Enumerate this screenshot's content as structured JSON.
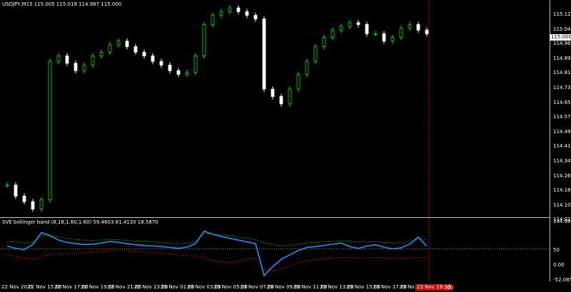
{
  "main": {
    "symbol_header": "USDJPY,M15  115.005 115.019 114.987 115.000",
    "current_price": "115.000",
    "price_labels": [
      "115.125",
      "115.045",
      "114.965",
      "114.890",
      "114.810",
      "114.730",
      "114.650",
      "114.575",
      "114.495",
      "114.415",
      "114.340",
      "114.260",
      "114.180",
      "114.100",
      "114.025"
    ]
  },
  "indicator": {
    "header": "SVE bollinger band (8,18,1.60,1.60) 59.4603 81.4130 18.5870",
    "labels": [
      "144.9853",
      "50",
      "0.00",
      "-52.0858"
    ]
  },
  "time_axis": {
    "labels": [
      "22 Nov 2021",
      "22 Nov 15:00",
      "22 Nov 17:00",
      "22 Nov 19:00",
      "22 Nov 21:00",
      "22 Nov 23:00",
      "23 Nov 01:00",
      "23 Nov 03:00",
      "23 Nov 05:00",
      "23 Nov 07:00",
      "23 Nov 09:00",
      "23 Nov 11:00",
      "23 Nov 13:00",
      "23 Nov 15:00",
      "23 Nov 17:00",
      "23 No"
    ],
    "crosshair_tag": "23 Nov 19:30",
    "crosshair_suffix": ":00"
  },
  "colors": {
    "bull": "#00e000",
    "bear": "#ffffff",
    "indicator_line": "#1e90ff",
    "upper_band": "#00c000",
    "lower_band": "#e00000",
    "crosshair": "#e00000"
  },
  "chart_data": {
    "type": "line",
    "close_series": [
      114.18,
      114.12,
      114.09,
      114.05,
      114.1,
      114.85,
      114.88,
      114.84,
      114.8,
      114.83,
      114.88,
      114.9,
      114.94,
      114.96,
      114.93,
      114.9,
      114.88,
      114.85,
      114.83,
      114.8,
      114.78,
      114.79,
      114.88,
      115.05,
      115.1,
      115.12,
      115.14,
      115.12,
      115.1,
      115.08,
      114.7,
      114.66,
      114.62,
      114.7,
      114.78,
      114.85,
      114.93,
      114.98,
      115.02,
      115.04,
      115.06,
      115.05,
      115.0,
      115.0,
      114.96,
      114.98,
      115.03,
      115.05,
      115.02,
      115.0
    ],
    "indicator_series": [
      59,
      52,
      48,
      65,
      105,
      95,
      80,
      72,
      68,
      65,
      66,
      70,
      75,
      72,
      68,
      64,
      62,
      60,
      58,
      55,
      52,
      56,
      68,
      110,
      100,
      92,
      86,
      80,
      74,
      68,
      -40,
      -10,
      15,
      30,
      45,
      55,
      58,
      62,
      66,
      70,
      58,
      52,
      60,
      64,
      56,
      50,
      54,
      66,
      90,
      59
    ],
    "upper_band_series": [
      75,
      74,
      70,
      72,
      95,
      96,
      90,
      86,
      82,
      80,
      79,
      80,
      82,
      81,
      79,
      77,
      76,
      74,
      72,
      70,
      68,
      69,
      75,
      102,
      100,
      98,
      95,
      90,
      86,
      82,
      70,
      65,
      60,
      62,
      66,
      70,
      72,
      74,
      76,
      78,
      76,
      74,
      74,
      75,
      72,
      70,
      70,
      74,
      84,
      81
    ],
    "lower_band_series": [
      30,
      25,
      20,
      15,
      25,
      30,
      32,
      35,
      36,
      38,
      40,
      42,
      44,
      45,
      44,
      42,
      40,
      38,
      36,
      34,
      30,
      28,
      25,
      20,
      10,
      6,
      4,
      8,
      14,
      20,
      -20,
      -25,
      -18,
      -8,
      2,
      10,
      15,
      18,
      20,
      22,
      22,
      20,
      20,
      22,
      20,
      18,
      18,
      20,
      22,
      19
    ],
    "ylim_price": [
      114.025,
      115.125
    ],
    "ylim_indicator": [
      -52.0858,
      144.9853
    ]
  }
}
